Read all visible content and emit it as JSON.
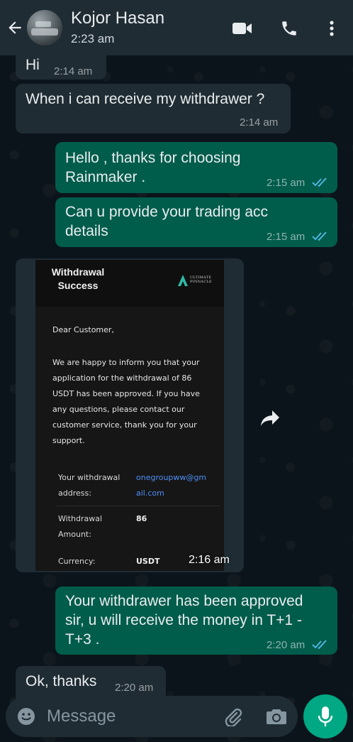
{
  "header": {
    "contact_name": "Kojor Hasan",
    "status": "2:23 am",
    "icons": [
      "back-arrow-icon",
      "video-call-icon",
      "phone-icon",
      "more-vertical-icon"
    ]
  },
  "messages": [
    {
      "direction": "in",
      "text": "Hi",
      "time": "2:14 am"
    },
    {
      "direction": "in",
      "text": "When i can receive my withdrawer ?",
      "time": "2:14 am"
    },
    {
      "direction": "out",
      "text": "Hello , thanks for choosing\nRainmaker .",
      "time": "2:15 am",
      "read": true
    },
    {
      "direction": "out",
      "text": "Can u provide your trading acc\ndetails",
      "time": "2:15 am",
      "read": true
    },
    {
      "direction": "in",
      "type": "image",
      "time": "2:16 am"
    },
    {
      "direction": "out",
      "text": "Your withdrawer has been approved\nsir, u will receive the money in T+1 -\nT+3 .",
      "time": "2:20 am",
      "read": true
    },
    {
      "direction": "in",
      "text": "Ok, thanks",
      "time": "2:20 am"
    }
  ],
  "receipt": {
    "title": "Withdrawal\nSuccess",
    "logo_text": "ULTIMATE\nPINNACLE",
    "greeting": "Dear Customer,",
    "body": "We are happy to inform you that your application for the withdrawal of 86 USDT has been approved. If you have any questions, please contact our customer service, thank you for your support.",
    "address_label": "Your withdrawal\naddress:",
    "address_value": "onegroupww@gm\nail.com",
    "amount_label": "Withdrawal\nAmount:",
    "amount_value": "86",
    "currency_label": "Currency:",
    "currency_value": "USDT"
  },
  "composer": {
    "placeholder": "Message",
    "icons": [
      "emoji-icon",
      "attach-icon",
      "camera-icon",
      "mic-icon"
    ]
  },
  "colors": {
    "background": "#0b141a",
    "header": "#1f2c34",
    "incoming": "#202c33",
    "outgoing": "#005c4b",
    "tick_read": "#53bdeb",
    "accent": "#00a884"
  }
}
